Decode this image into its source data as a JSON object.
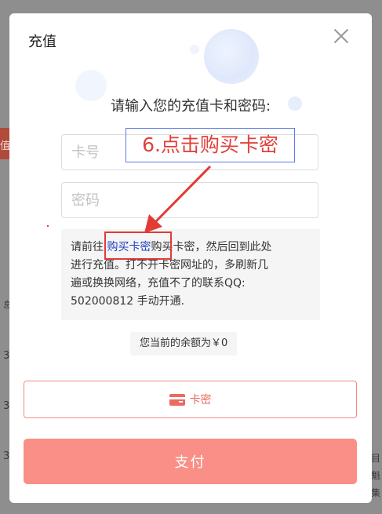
{
  "background": {
    "strip_text": "值",
    "row_numbers": [
      "3",
      "3",
      "3"
    ],
    "right_chars": [
      "目",
      "魁",
      "集"
    ],
    "left_char": "息"
  },
  "modal": {
    "title": "充值",
    "prompt": "请输入您的充值卡和密码:",
    "card_input": {
      "value": "",
      "placeholder": "卡号"
    },
    "password_input": {
      "value": "",
      "placeholder": "密码"
    },
    "notice": {
      "prefix": "请前往",
      "link": "购买卡密",
      "suffix": "购买卡密，然后回到此处",
      "line2": "进行充值。打不开卡密网址的，多刷新几",
      "line3": "遍或换换网络，充值不了的联系QQ:",
      "line4": "502000812 手动开通."
    },
    "balance": "您当前的余额为￥0",
    "method_label": "卡密",
    "pay_label": "支付"
  },
  "annotation": {
    "label": "6.点击购买卡密"
  },
  "colors": {
    "accent": "#f98f86",
    "method_border": "#f08a80",
    "annotation_red": "#e23b35",
    "link_blue": "#1f3fbf"
  }
}
